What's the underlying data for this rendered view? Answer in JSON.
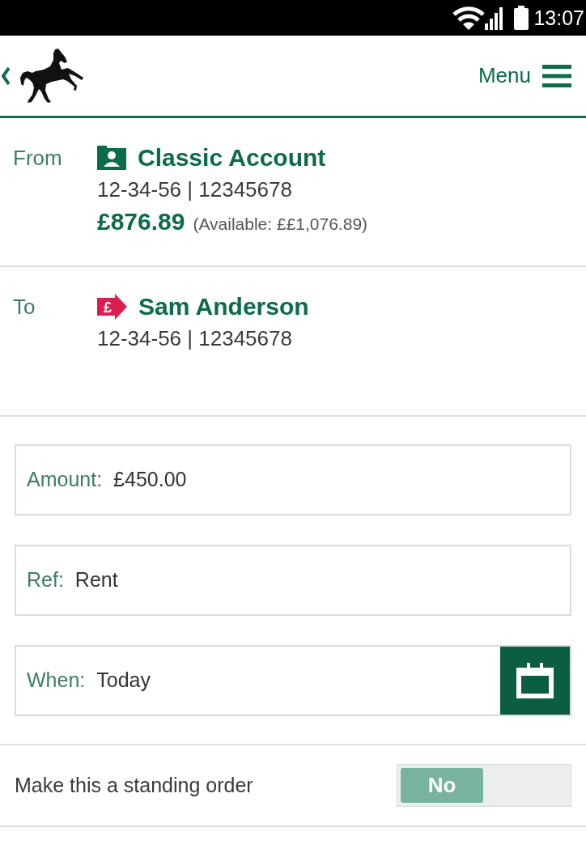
{
  "status_bar": {
    "time": "13:07"
  },
  "header": {
    "menu_label": "Menu"
  },
  "from": {
    "label": "From",
    "account_name": "Classic Account",
    "account_number": "12-34-56 | 12345678",
    "balance": "£876.89",
    "available": "(Available: ££1,076.89)"
  },
  "to": {
    "label": "To",
    "icon_symbol": "£",
    "payee_name": "Sam Anderson",
    "account_number": "12-34-56 | 12345678"
  },
  "fields": [
    {
      "kind": "text",
      "label": "Amount:",
      "value": "£450.00"
    },
    {
      "kind": "text",
      "label": "Ref:",
      "value": "Rent"
    },
    {
      "kind": "date",
      "label": "When:",
      "value": "Today"
    }
  ],
  "standing_order": {
    "label": "Make this a standing order",
    "toggle_label": "No",
    "on": false
  }
}
